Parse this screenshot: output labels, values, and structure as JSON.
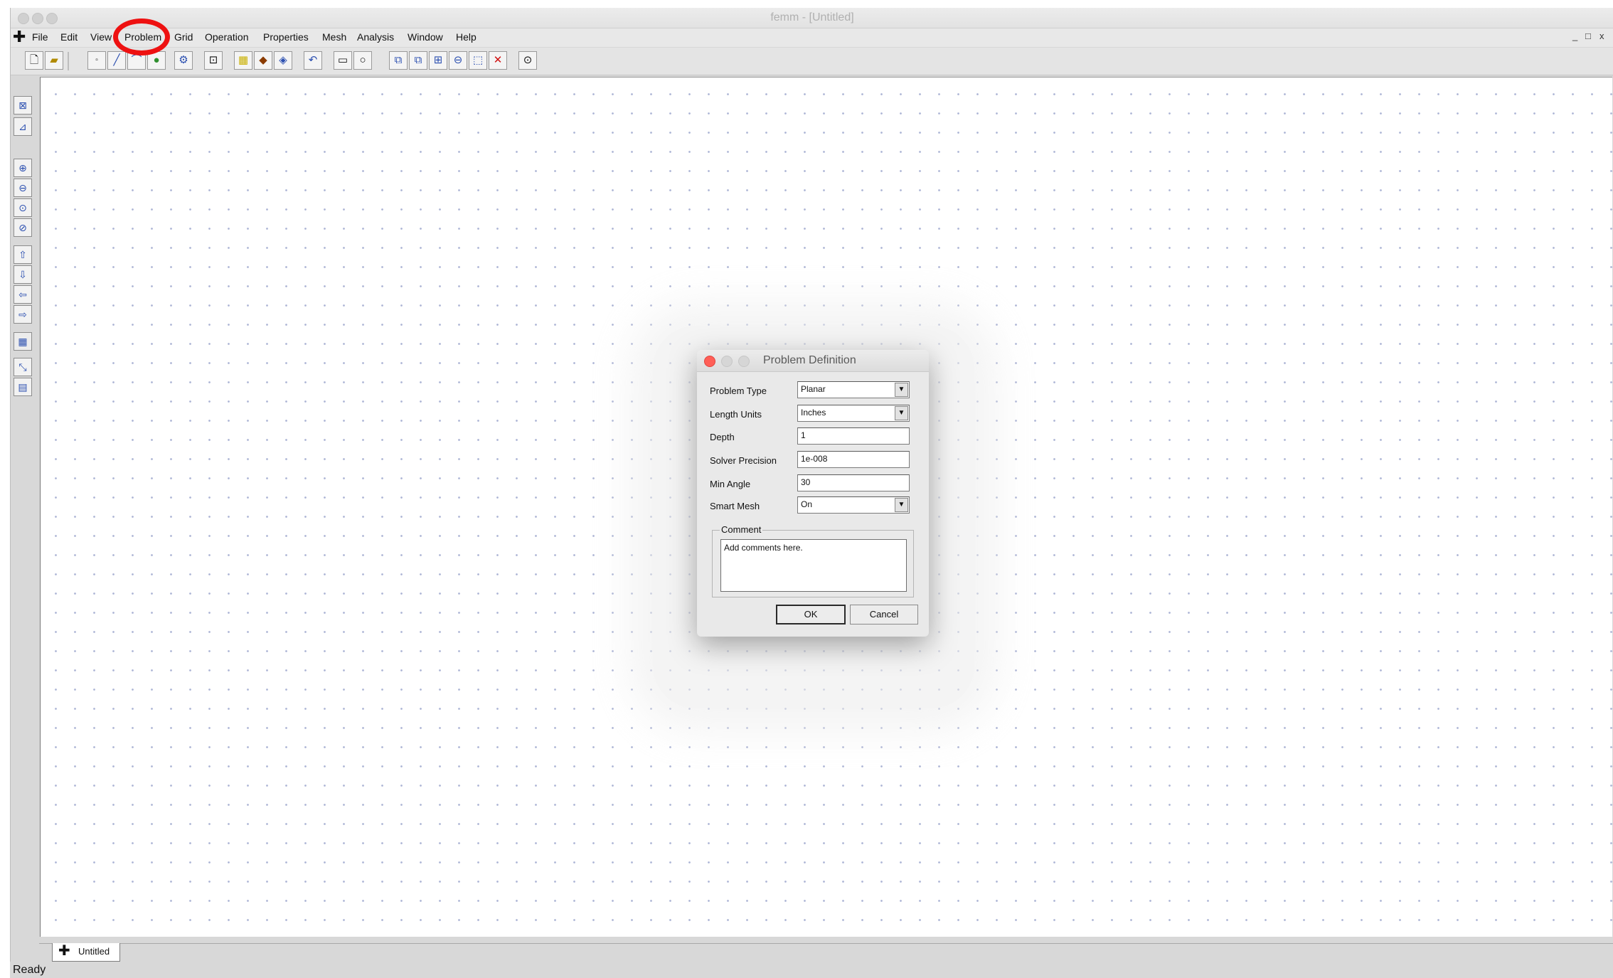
{
  "window": {
    "title": "femm - [Untitled]"
  },
  "menu": {
    "items": [
      "File",
      "Edit",
      "View",
      "Problem",
      "Grid",
      "Operation",
      "Properties",
      "Mesh",
      "Analysis",
      "Window",
      "Help"
    ],
    "highlighted": "Problem",
    "mdi_controls": [
      "_",
      "□",
      "x"
    ]
  },
  "toolbar": {
    "icons": [
      "new-file",
      "open-file",
      "node-mode",
      "segment-mode",
      "arc-mode",
      "block-mode",
      "group-mode",
      "select-window",
      "create-mesh",
      "run-analysis",
      "view-results",
      "undo",
      "rectangle",
      "circle",
      "copy",
      "mirror",
      "scale",
      "zoom-out",
      "move",
      "delete",
      "settings"
    ]
  },
  "left_toolbar": {
    "icons": [
      "show-names",
      "show-points",
      "zoom-in",
      "zoom-out",
      "zoom-natural",
      "zoom-window",
      "pan-up",
      "pan-down",
      "pan-left",
      "pan-right",
      "show-grid",
      "snap-grid",
      "grid-settings"
    ]
  },
  "document_tab": {
    "label": "Untitled"
  },
  "status": {
    "text": "Ready"
  },
  "dialog": {
    "title": "Problem Definition",
    "fields": {
      "problem_type": {
        "label": "Problem Type",
        "value": "Planar"
      },
      "length_units": {
        "label": "Length Units",
        "value": "Inches"
      },
      "depth": {
        "label": "Depth",
        "value": "1"
      },
      "solver_precision": {
        "label": "Solver Precision",
        "value": "1e-008"
      },
      "min_angle": {
        "label": "Min Angle",
        "value": "30"
      },
      "smart_mesh": {
        "label": "Smart Mesh",
        "value": "On"
      }
    },
    "comment": {
      "legend": "Comment",
      "value": "Add comments here."
    },
    "buttons": {
      "ok": "OK",
      "cancel": "Cancel"
    }
  },
  "colors": {
    "highlight_circle": "#ee1111",
    "close_light": "#ff5f57",
    "grid_dot": "#aeb6d6"
  }
}
